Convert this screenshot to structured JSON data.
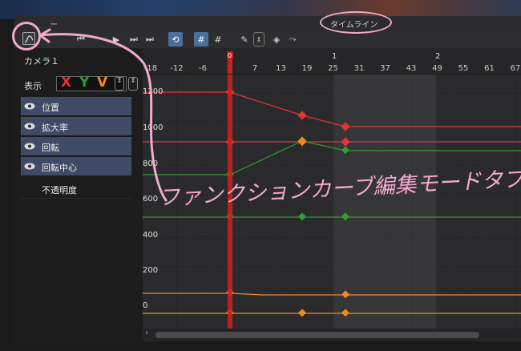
{
  "window": {
    "title": "タイムライン",
    "menu_fragment": "ー"
  },
  "annotation": {
    "handwritten_text": "ファンクションカーブ編集モードタブ"
  },
  "toolbar": {
    "buttons": [
      {
        "name": "function-curve-button",
        "active": false
      },
      {
        "name": "previous-keyframe-button"
      },
      {
        "name": "play-button"
      },
      {
        "name": "next-frame-button"
      },
      {
        "name": "last-frame-button"
      },
      {
        "name": "loop-button",
        "active": true
      },
      {
        "name": "grid-snap-button",
        "active": true
      },
      {
        "name": "grid-button"
      },
      {
        "name": "pen-tool-button"
      },
      {
        "name": "stepper-button"
      },
      {
        "name": "delete-key-button"
      },
      {
        "name": "curve-handle-button"
      }
    ]
  },
  "panel": {
    "camera_name": "カメラ１",
    "display_label": "表示",
    "axes": [
      "X",
      "Y",
      "V"
    ],
    "properties": [
      {
        "label": "位置",
        "visible": true,
        "selected": true
      },
      {
        "label": "拡大率",
        "visible": true,
        "selected": true
      },
      {
        "label": "回転",
        "visible": true,
        "selected": true
      },
      {
        "label": "回転中心",
        "visible": true,
        "selected": true
      },
      {
        "label": "不透明度",
        "visible": false,
        "selected": false
      }
    ]
  },
  "timeline": {
    "section_markers": [
      "1",
      "2"
    ],
    "frame_ticks": [
      "-18",
      "-12",
      "-6",
      "1",
      "7",
      "13",
      "19",
      "25",
      "31",
      "37",
      "43",
      "49",
      "55",
      "61",
      "67"
    ],
    "current_frame": "0",
    "value_ticks": [
      "1200",
      "1000",
      "800",
      "600",
      "400",
      "200",
      "0"
    ]
  },
  "colors": {
    "x": "#e23434",
    "y": "#2f9d2f",
    "z": "#f08a1a",
    "annotation": "#f4a8cc",
    "playhead": "#c8201f"
  }
}
